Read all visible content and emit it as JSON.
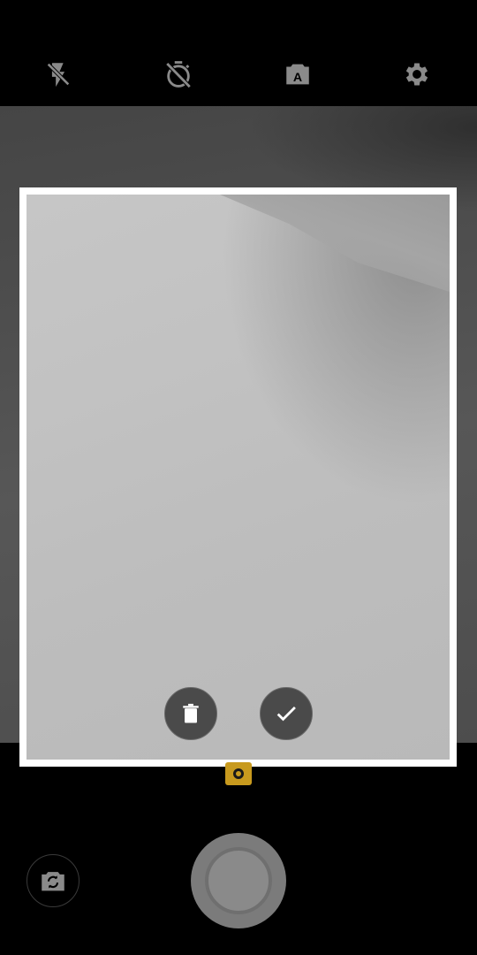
{
  "app": {
    "name": "Camera"
  },
  "toolbar": {
    "icons": [
      "flash-off-icon",
      "timer-off-icon",
      "auto-scene-icon",
      "settings-icon"
    ],
    "auto_scene_letter": "A"
  },
  "preview": {
    "actions": [
      "delete",
      "confirm"
    ]
  },
  "controls": {
    "mode": "photo",
    "accent_color": "#c89a1e"
  },
  "colors": {
    "background": "#000000",
    "frame_border": "#ffffff",
    "button_bg": "#4a4a4a",
    "shutter": "#7b7b7b"
  }
}
